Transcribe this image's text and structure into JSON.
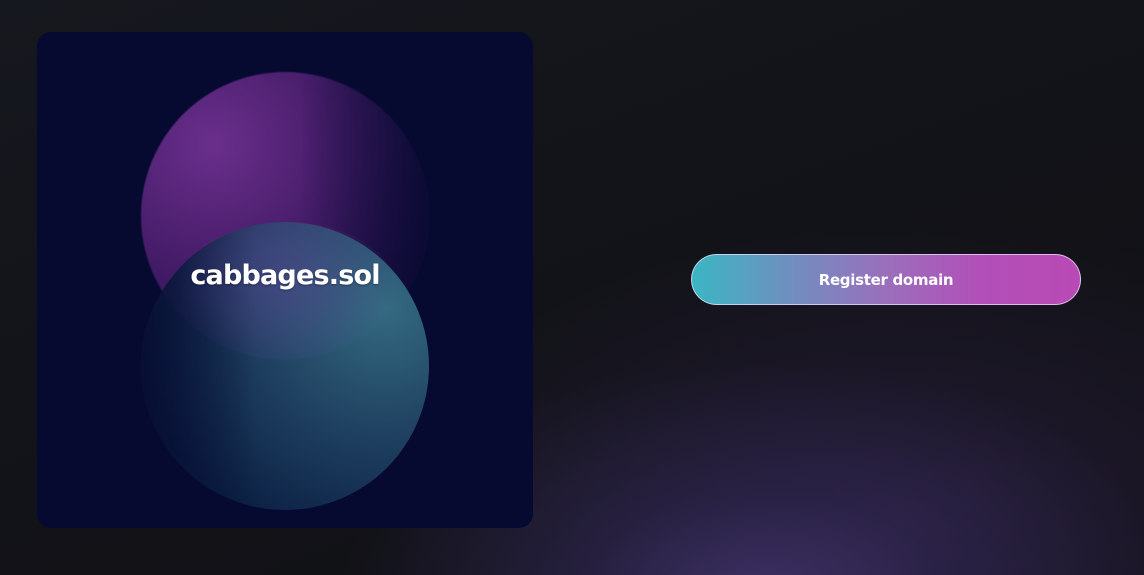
{
  "domain_card": {
    "domain_name": "cabbages.sol"
  },
  "actions": {
    "register_label": "Register domain"
  },
  "colors": {
    "card_background": "#070a30",
    "button_gradient_start": "#3bb6c3",
    "button_gradient_end": "#b94ab5",
    "orb_purple": "#6a2f8c",
    "orb_teal": "#3a788c"
  }
}
